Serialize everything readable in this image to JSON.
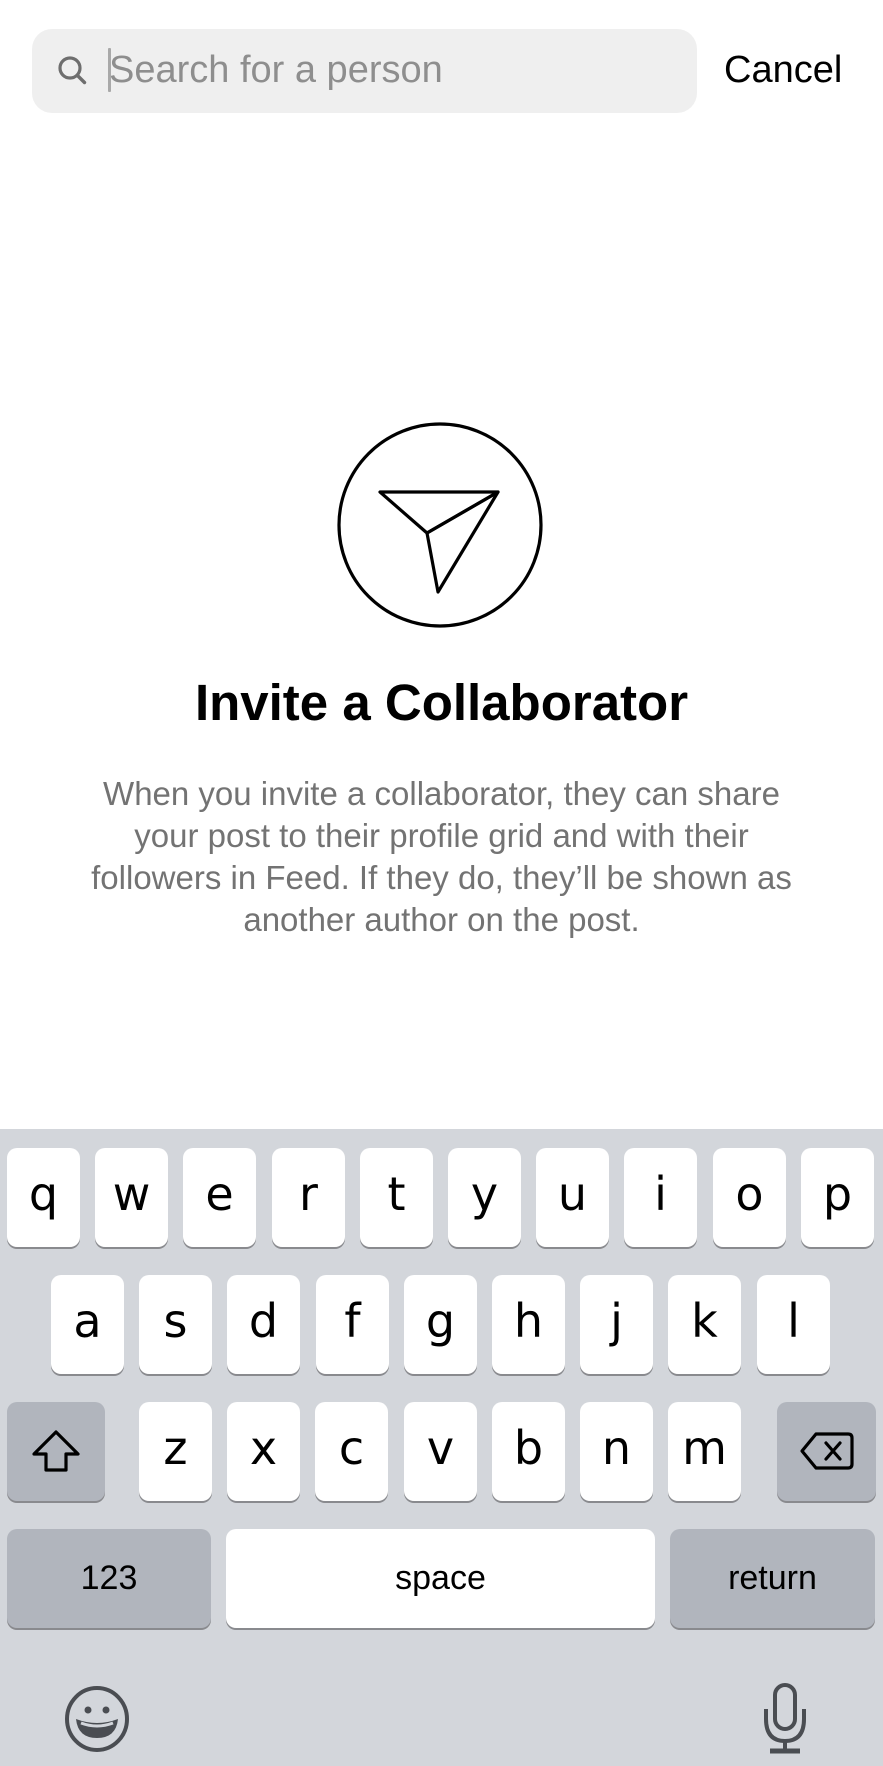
{
  "search": {
    "placeholder": "Search for a person",
    "value": "",
    "cancel_label": "Cancel"
  },
  "empty_state": {
    "icon": "paper-plane-in-circle-icon",
    "title": "Invite a Collaborator",
    "description": "When you invite a collaborator, they can share your post to their profile grid and with their followers in Feed. If they do, they’ll be shown as another author on the post."
  },
  "keyboard": {
    "row1": [
      "q",
      "w",
      "e",
      "r",
      "t",
      "y",
      "u",
      "i",
      "o",
      "p"
    ],
    "row2": [
      "a",
      "s",
      "d",
      "f",
      "g",
      "h",
      "j",
      "k",
      "l"
    ],
    "row3": [
      "z",
      "x",
      "c",
      "v",
      "b",
      "n",
      "m"
    ],
    "shift_icon": "shift-arrow-icon",
    "delete_icon": "backspace-icon",
    "numbers_label": "123",
    "space_label": "space",
    "return_label": "return",
    "emoji_icon": "emoji-smiley-icon",
    "dictation_icon": "microphone-icon"
  },
  "colors": {
    "keyboard_bg": "#d3d6db",
    "key_bg": "#ffffff",
    "special_key_bg": "#b1b5bd",
    "placeholder": "#8e8e8e",
    "body_text": "#737373"
  }
}
